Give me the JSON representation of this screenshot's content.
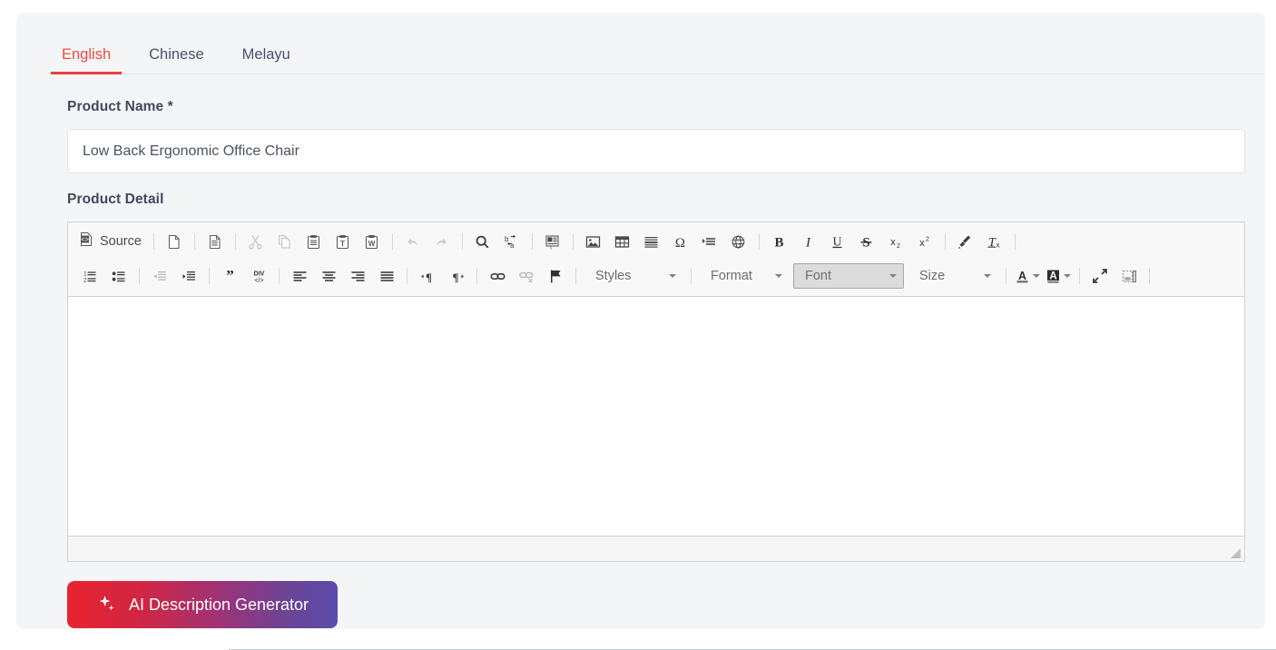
{
  "tabs": [
    {
      "label": "English",
      "active": true
    },
    {
      "label": "Chinese",
      "active": false
    },
    {
      "label": "Melayu",
      "active": false
    }
  ],
  "form": {
    "product_name_label": "Product Name *",
    "product_name_value": "Low Back Ergonomic Office Chair",
    "product_name_placeholder": "Product Name",
    "product_detail_label": "Product Detail",
    "product_detail_value": ""
  },
  "editor": {
    "source_label": "Source",
    "toolbar_row1": [
      {
        "name": "new-page-icon",
        "title": "New Page",
        "disabled": false
      },
      {
        "name": "templates-icon",
        "title": "Templates",
        "disabled": false
      },
      {
        "name": "cut-icon",
        "title": "Cut",
        "disabled": true
      },
      {
        "name": "copy-icon",
        "title": "Copy",
        "disabled": true
      },
      {
        "name": "paste-icon",
        "title": "Paste",
        "disabled": false
      },
      {
        "name": "paste-as-text-icon",
        "title": "Paste as plain text",
        "disabled": false
      },
      {
        "name": "paste-from-word-icon",
        "title": "Paste from Word",
        "disabled": false
      },
      {
        "name": "undo-icon",
        "title": "Undo",
        "disabled": true
      },
      {
        "name": "redo-icon",
        "title": "Redo",
        "disabled": true
      },
      {
        "name": "find-icon",
        "title": "Find",
        "disabled": false
      },
      {
        "name": "replace-icon",
        "title": "Replace",
        "disabled": false
      },
      {
        "name": "select-all-icon",
        "title": "Select All",
        "disabled": false
      },
      {
        "name": "image-icon",
        "title": "Image",
        "disabled": false
      },
      {
        "name": "table-icon",
        "title": "Table",
        "disabled": false
      },
      {
        "name": "horizontal-rule-icon",
        "title": "Horizontal Line",
        "disabled": false
      },
      {
        "name": "special-character-icon",
        "title": "Insert Special Character",
        "disabled": false
      },
      {
        "name": "page-break-icon",
        "title": "Page Break",
        "disabled": false
      },
      {
        "name": "iframe-icon",
        "title": "IFrame",
        "disabled": false
      },
      {
        "name": "bold-icon",
        "title": "Bold",
        "disabled": false
      },
      {
        "name": "italic-icon",
        "title": "Italic",
        "disabled": false
      },
      {
        "name": "underline-icon",
        "title": "Underline",
        "disabled": false
      },
      {
        "name": "strikethrough-icon",
        "title": "Strikethrough",
        "disabled": false
      },
      {
        "name": "subscript-icon",
        "title": "Subscript",
        "disabled": false
      },
      {
        "name": "superscript-icon",
        "title": "Superscript",
        "disabled": false
      },
      {
        "name": "copy-formatting-icon",
        "title": "Copy Formatting",
        "disabled": false
      },
      {
        "name": "remove-format-icon",
        "title": "Remove Format",
        "disabled": false
      }
    ],
    "toolbar_row2": [
      {
        "name": "numbered-list-icon",
        "title": "Insert/Remove Numbered List",
        "disabled": false
      },
      {
        "name": "bulleted-list-icon",
        "title": "Insert/Remove Bulleted List",
        "disabled": false
      },
      {
        "name": "decrease-indent-icon",
        "title": "Decrease Indent",
        "disabled": true
      },
      {
        "name": "increase-indent-icon",
        "title": "Increase Indent",
        "disabled": false
      },
      {
        "name": "blockquote-icon",
        "title": "Block Quote",
        "disabled": false
      },
      {
        "name": "div-container-icon",
        "title": "Create Div Container",
        "disabled": false
      },
      {
        "name": "align-left-icon",
        "title": "Align Left",
        "disabled": false
      },
      {
        "name": "align-center-icon",
        "title": "Center",
        "disabled": false
      },
      {
        "name": "align-right-icon",
        "title": "Align Right",
        "disabled": false
      },
      {
        "name": "justify-icon",
        "title": "Justify",
        "disabled": false
      },
      {
        "name": "text-direction-ltr-icon",
        "title": "Text direction from left to right",
        "disabled": false
      },
      {
        "name": "text-direction-rtl-icon",
        "title": "Text direction from right to left",
        "disabled": false
      },
      {
        "name": "link-icon",
        "title": "Link",
        "disabled": false
      },
      {
        "name": "unlink-icon",
        "title": "Unlink",
        "disabled": true
      },
      {
        "name": "anchor-icon",
        "title": "Anchor",
        "disabled": false
      }
    ],
    "dropdowns": {
      "styles": "Styles",
      "format": "Format",
      "font": "Font",
      "size": "Size"
    },
    "toolbar_row2_end": [
      {
        "name": "text-color-icon",
        "title": "Text Color",
        "disabled": false
      },
      {
        "name": "background-color-icon",
        "title": "Background Color",
        "disabled": false
      },
      {
        "name": "maximize-icon",
        "title": "Maximize",
        "disabled": false
      },
      {
        "name": "show-blocks-icon",
        "title": "Show Blocks",
        "disabled": false
      }
    ]
  },
  "ai_button": {
    "label": "AI Description Generator",
    "icon": "sparkle-icon",
    "gradient_from": "#e8242e",
    "gradient_to": "#5a4bab"
  },
  "colors": {
    "accent_red": "#e8433a",
    "tab_text": "#47536b",
    "card_bg": "#f4f5f7",
    "toolbar_bg": "#f8f8f8",
    "editor_border": "#d1d1d1"
  }
}
